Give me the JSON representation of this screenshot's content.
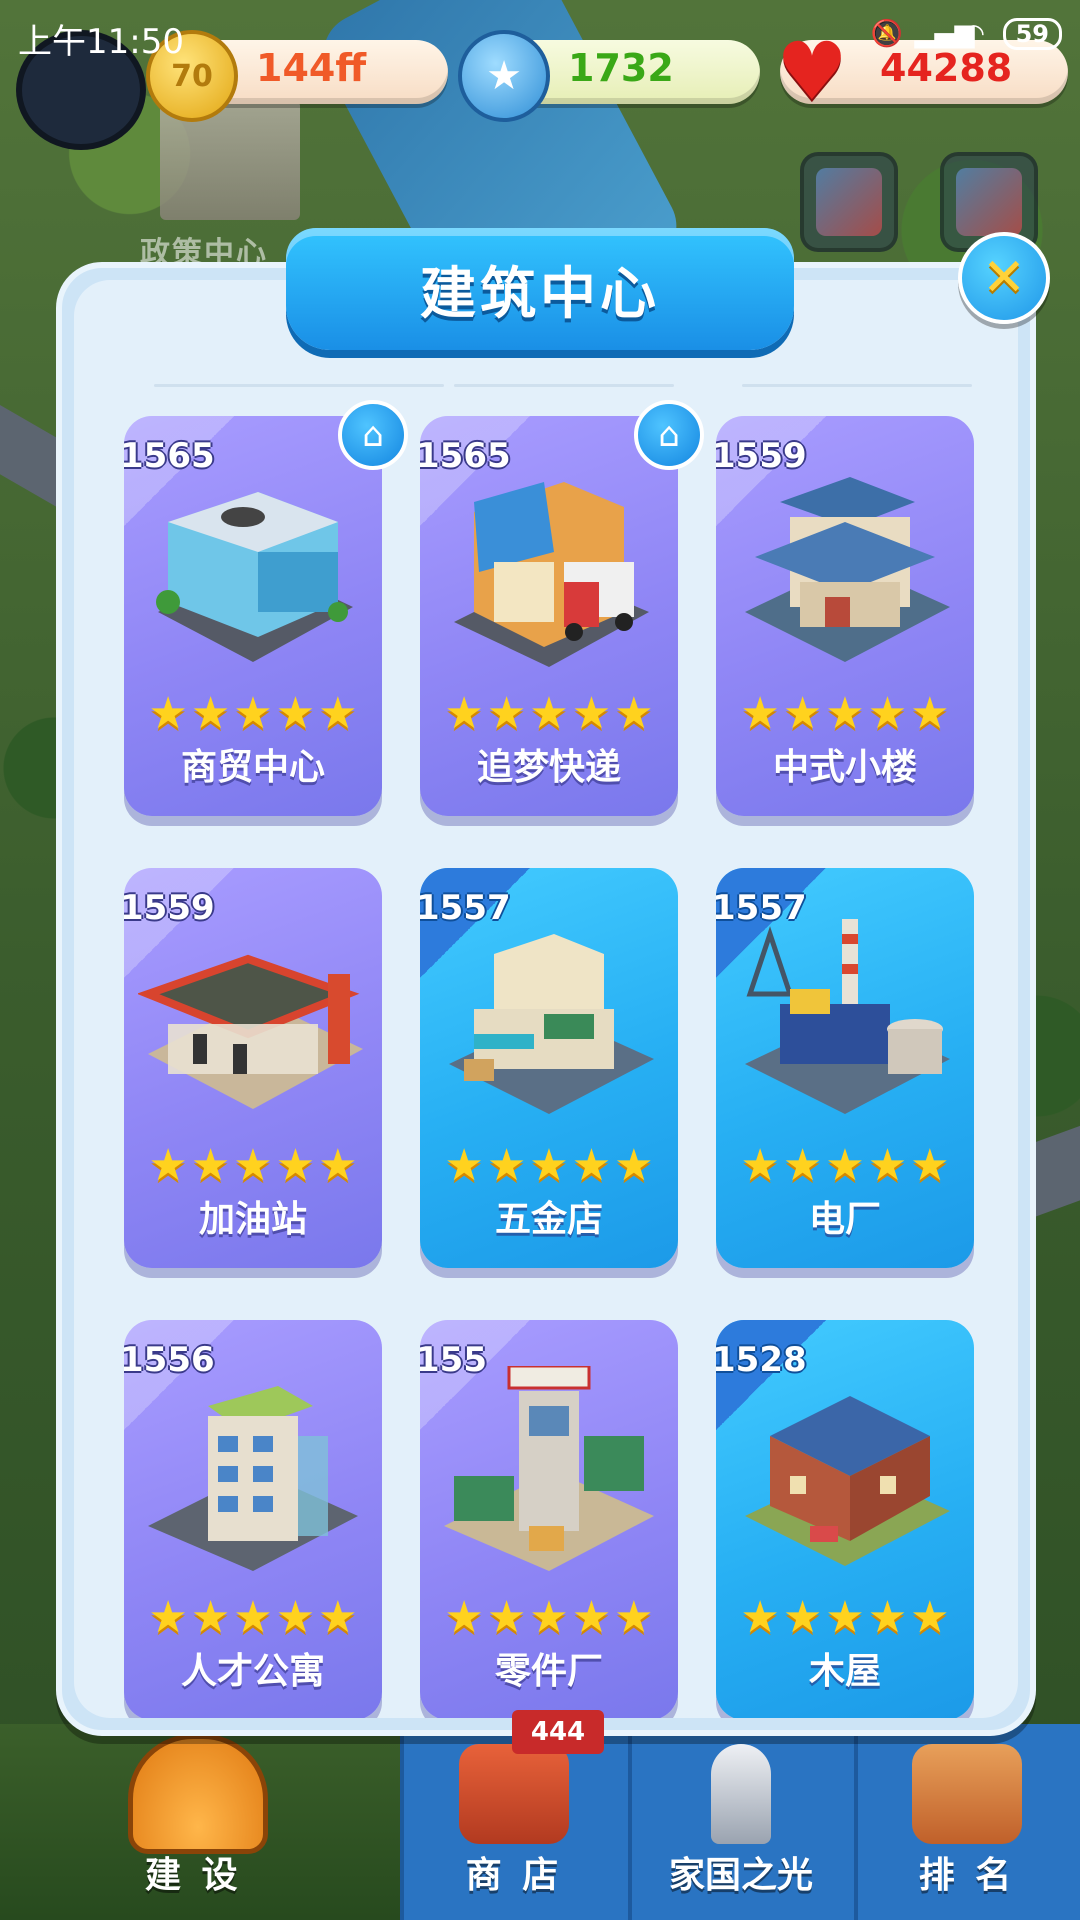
{
  "status_bar": {
    "time": "上午11:50",
    "battery": "59"
  },
  "background": {
    "building_label": "政策中心"
  },
  "resources": [
    {
      "name": "coin",
      "icon": "coin-icon",
      "icon_text": "70",
      "value": "144ff",
      "color": "#f05a28"
    },
    {
      "name": "gem",
      "icon": "star-coin-icon",
      "value": "1732",
      "color": "#3aa817"
    },
    {
      "name": "heart",
      "icon": "heart-icon",
      "value": "44288",
      "color": "#e5241f"
    }
  ],
  "panel": {
    "title": "建筑中心",
    "close_icon": "close-icon"
  },
  "buildings": [
    {
      "level": "1565",
      "name": "商贸中心",
      "stars": 5,
      "theme": "purple",
      "home_badge": true
    },
    {
      "level": "1565",
      "name": "追梦快递",
      "stars": 5,
      "theme": "purple",
      "home_badge": true
    },
    {
      "level": "1559",
      "name": "中式小楼",
      "stars": 5,
      "theme": "purple",
      "home_badge": false
    },
    {
      "level": "1559",
      "name": "加油站",
      "stars": 5,
      "theme": "purple",
      "home_badge": false
    },
    {
      "level": "1557",
      "name": "五金店",
      "stars": 5,
      "theme": "blue",
      "home_badge": false
    },
    {
      "level": "1557",
      "name": "电厂",
      "stars": 5,
      "theme": "blue",
      "home_badge": false
    },
    {
      "level": "1556",
      "name": "人才公寓",
      "stars": 5,
      "theme": "purple",
      "home_badge": false
    },
    {
      "level": "155",
      "name": "零件厂",
      "stars": 5,
      "theme": "purple",
      "home_badge": false
    },
    {
      "level": "1528",
      "name": "木屋",
      "stars": 5,
      "theme": "blue",
      "home_badge": false
    }
  ],
  "bottom_nav": {
    "badge": "444",
    "tabs": [
      {
        "label": "建 设",
        "icon": "helmet-icon",
        "active": true
      },
      {
        "label": "商 店",
        "icon": "shop-icon",
        "active": false
      },
      {
        "label": "家国之光",
        "icon": "rocket-icon",
        "active": false
      },
      {
        "label": "排 名",
        "icon": "ranking-icon",
        "active": false
      }
    ]
  }
}
